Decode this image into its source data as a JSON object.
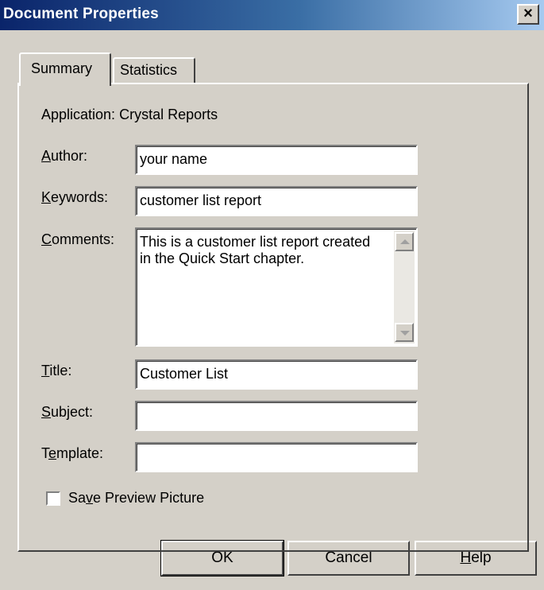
{
  "window": {
    "title": "Document Properties",
    "close_glyph": "×"
  },
  "tabs": [
    {
      "label": "Summary",
      "active": true
    },
    {
      "label": "Statistics",
      "active": false
    }
  ],
  "summary": {
    "application_label": "Application:",
    "application_value": "Crystal Reports",
    "author": {
      "label_first": "A",
      "label_rest": "uthor:",
      "value": "your name"
    },
    "keywords": {
      "label_first": "K",
      "label_rest": "eywords:",
      "value": "customer list report"
    },
    "comments": {
      "label_first": "C",
      "label_rest": "omments:",
      "value": "This is a customer list report created in the Quick Start chapter."
    },
    "title": {
      "label_first": "T",
      "label_rest": "itle:",
      "value": "Customer List"
    },
    "subject": {
      "label_first": "S",
      "label_rest": "ubject:",
      "value": ""
    },
    "template": {
      "label_pre": "T",
      "label_first": "e",
      "label_rest": "mplate:",
      "value": ""
    },
    "save_preview": {
      "label_pre": "Sa",
      "label_first": "v",
      "label_rest": "e Preview Picture",
      "checked": false
    }
  },
  "buttons": {
    "ok": "OK",
    "cancel": "Cancel",
    "help_first": "H",
    "help_rest": "elp"
  },
  "icons": {
    "close": "close-icon",
    "scroll_up": "scroll-up-arrow-icon",
    "scroll_down": "scroll-down-arrow-icon"
  },
  "colors": {
    "titlebar_start": "#0a246a",
    "titlebar_end": "#a6caf0",
    "face": "#d4d0c8"
  }
}
